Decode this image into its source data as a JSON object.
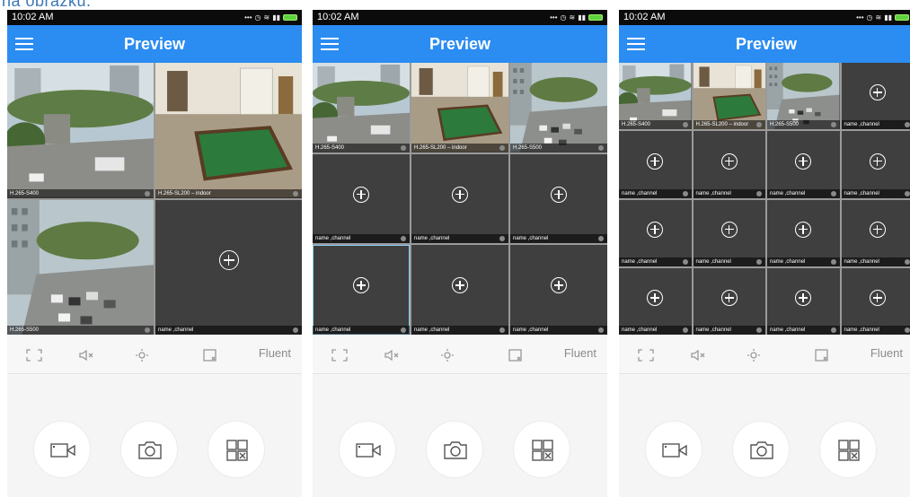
{
  "caption_fragment": "na obrázku.",
  "screens": [
    {
      "status_time": "10:02 AM",
      "title": "Preview",
      "layout": "4",
      "tiles": [
        {
          "label": "H.265-S400",
          "kind": "feed",
          "scene": "street"
        },
        {
          "label": "H.265-SL200 – indoor",
          "kind": "feed",
          "scene": "indoor"
        },
        {
          "label": "H.265-S500",
          "kind": "feed",
          "scene": "parking"
        },
        {
          "label": "name ,channel",
          "kind": "empty"
        }
      ],
      "stream_quality": "Fluent"
    },
    {
      "status_time": "10:02 AM",
      "title": "Preview",
      "layout": "9",
      "tiles": [
        {
          "label": "H.265-S400",
          "kind": "feed",
          "scene": "street"
        },
        {
          "label": "H.265-SL200 – indoor",
          "kind": "feed",
          "scene": "indoor"
        },
        {
          "label": "H.265-S500",
          "kind": "feed",
          "scene": "parking"
        },
        {
          "label": "name ,channel",
          "kind": "empty"
        },
        {
          "label": "name ,channel",
          "kind": "empty"
        },
        {
          "label": "name ,channel",
          "kind": "empty"
        },
        {
          "label": "name ,channel",
          "kind": "empty",
          "selected": true
        },
        {
          "label": "name ,channel",
          "kind": "empty"
        },
        {
          "label": "name ,channel",
          "kind": "empty"
        }
      ],
      "stream_quality": "Fluent"
    },
    {
      "status_time": "10:02 AM",
      "title": "Preview",
      "layout": "16",
      "tiles": [
        {
          "label": "H.265-S400",
          "kind": "feed",
          "scene": "street"
        },
        {
          "label": "H.265-SL200 – indoor",
          "kind": "feed",
          "scene": "indoor"
        },
        {
          "label": "H.265-S500",
          "kind": "feed",
          "scene": "parking"
        },
        {
          "label": "name ,channel",
          "kind": "empty"
        },
        {
          "label": "name ,channel",
          "kind": "empty"
        },
        {
          "label": "name ,channel",
          "kind": "empty"
        },
        {
          "label": "name ,channel",
          "kind": "empty"
        },
        {
          "label": "name ,channel",
          "kind": "empty"
        },
        {
          "label": "name ,channel",
          "kind": "empty"
        },
        {
          "label": "name ,channel",
          "kind": "empty"
        },
        {
          "label": "name ,channel",
          "kind": "empty"
        },
        {
          "label": "name ,channel",
          "kind": "empty"
        },
        {
          "label": "name ,channel",
          "kind": "empty"
        },
        {
          "label": "name ,channel",
          "kind": "empty"
        },
        {
          "label": "name ,channel",
          "kind": "empty"
        },
        {
          "label": "name ,channel",
          "kind": "empty"
        }
      ],
      "stream_quality": "Fluent"
    }
  ],
  "toolbar_icons": [
    "fullscreen-icon",
    "mute-icon",
    "ptz-icon",
    "close-window-icon"
  ],
  "bottom_buttons": [
    "record-button",
    "snapshot-button",
    "layout-switch-button"
  ],
  "colors": {
    "appbar": "#2b8cf2",
    "statusbar": "#0b0b0b",
    "tile_bg": "#3f3f3f",
    "selected_border": "#8ed0f8"
  }
}
